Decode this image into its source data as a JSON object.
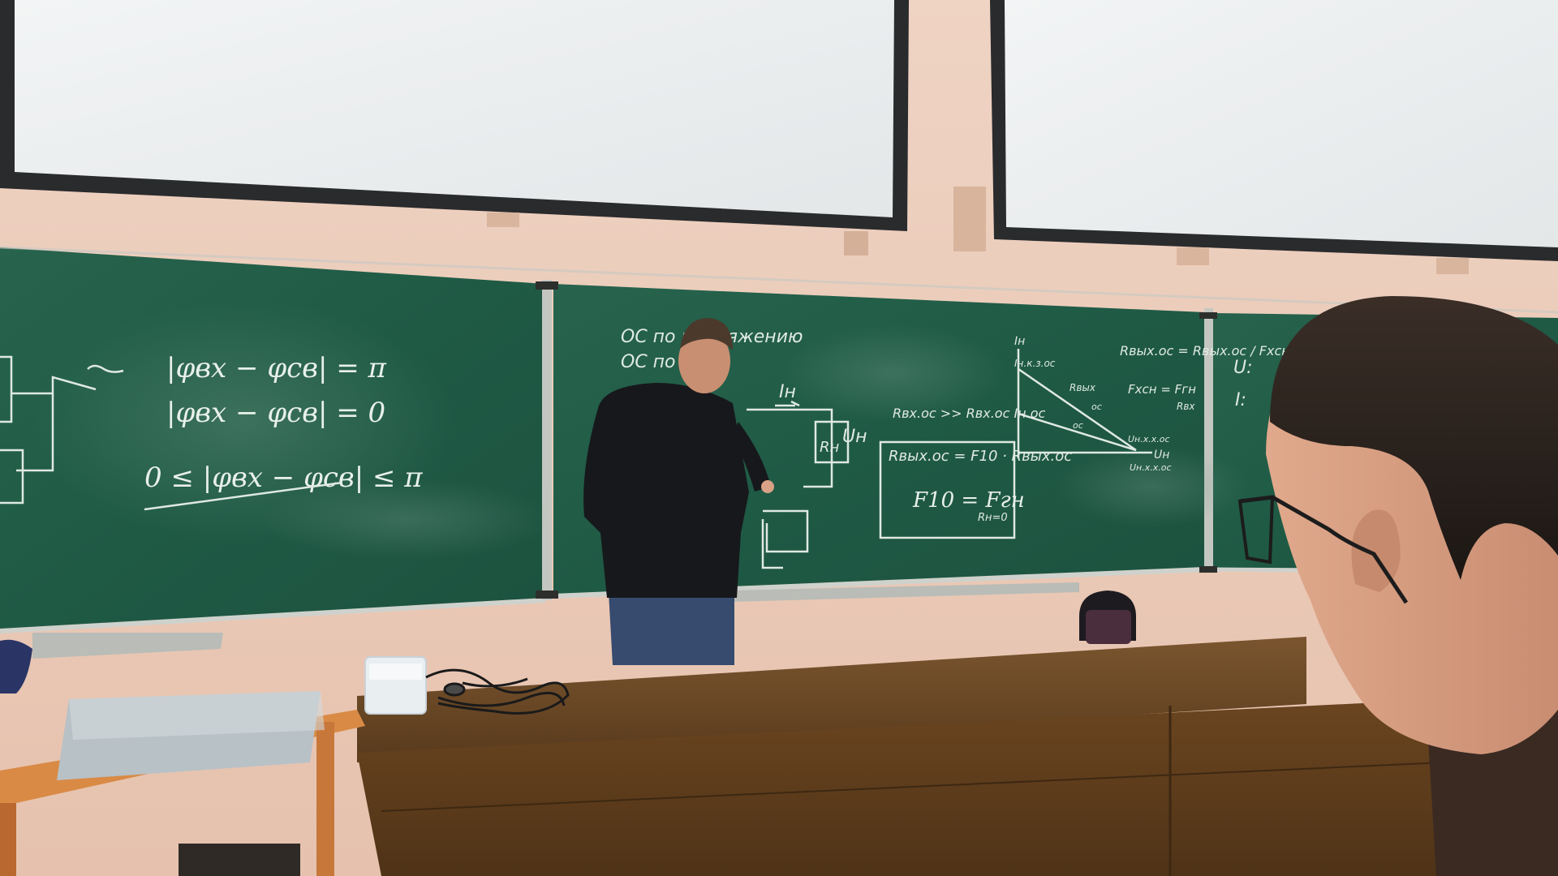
{
  "board_left": {
    "eq1": "|φвх − φсв| = π",
    "eq2": "|φвх − φсв| = 0",
    "eq3": "0 ≤ |φвх − φсв| ≤ π"
  },
  "board_center": {
    "line1": "ОС по напряжению",
    "line2": "ОС по",
    "label_in": "Iн",
    "label_un": "Uн",
    "label_rn": "Rн"
  },
  "board_formulas": {
    "f1": "Rвх.ос >> Rвх.ос Iн.ос",
    "f2": "Rвых.ос = F10 · Rвых.ос",
    "f3": "F10 = Fгн",
    "f3_sub": "Rн=0",
    "f4": "Rвых.ос = Rвых.ос / Fхсн",
    "f5": "Fхсн = Fгн",
    "f5_sub": "Rвх"
  },
  "graph": {
    "y_axis": "Iн",
    "y_tick": "Iн.к.з.ос",
    "x_axis": "Uн",
    "x_tick1": "Uн.х.х.ос",
    "x_tick2": "Uн.х.х.ос",
    "curve1": "Rвых",
    "curve2": "ос",
    "curve3": "ос"
  },
  "board_right": {
    "l1": "U:",
    "l2": "I:"
  },
  "colors": {
    "board": "#1f5a45",
    "wall": "#e9c9b8",
    "screen": "#eef1f2",
    "desk": "#6a4826",
    "chalk": "#e8f0ea"
  }
}
